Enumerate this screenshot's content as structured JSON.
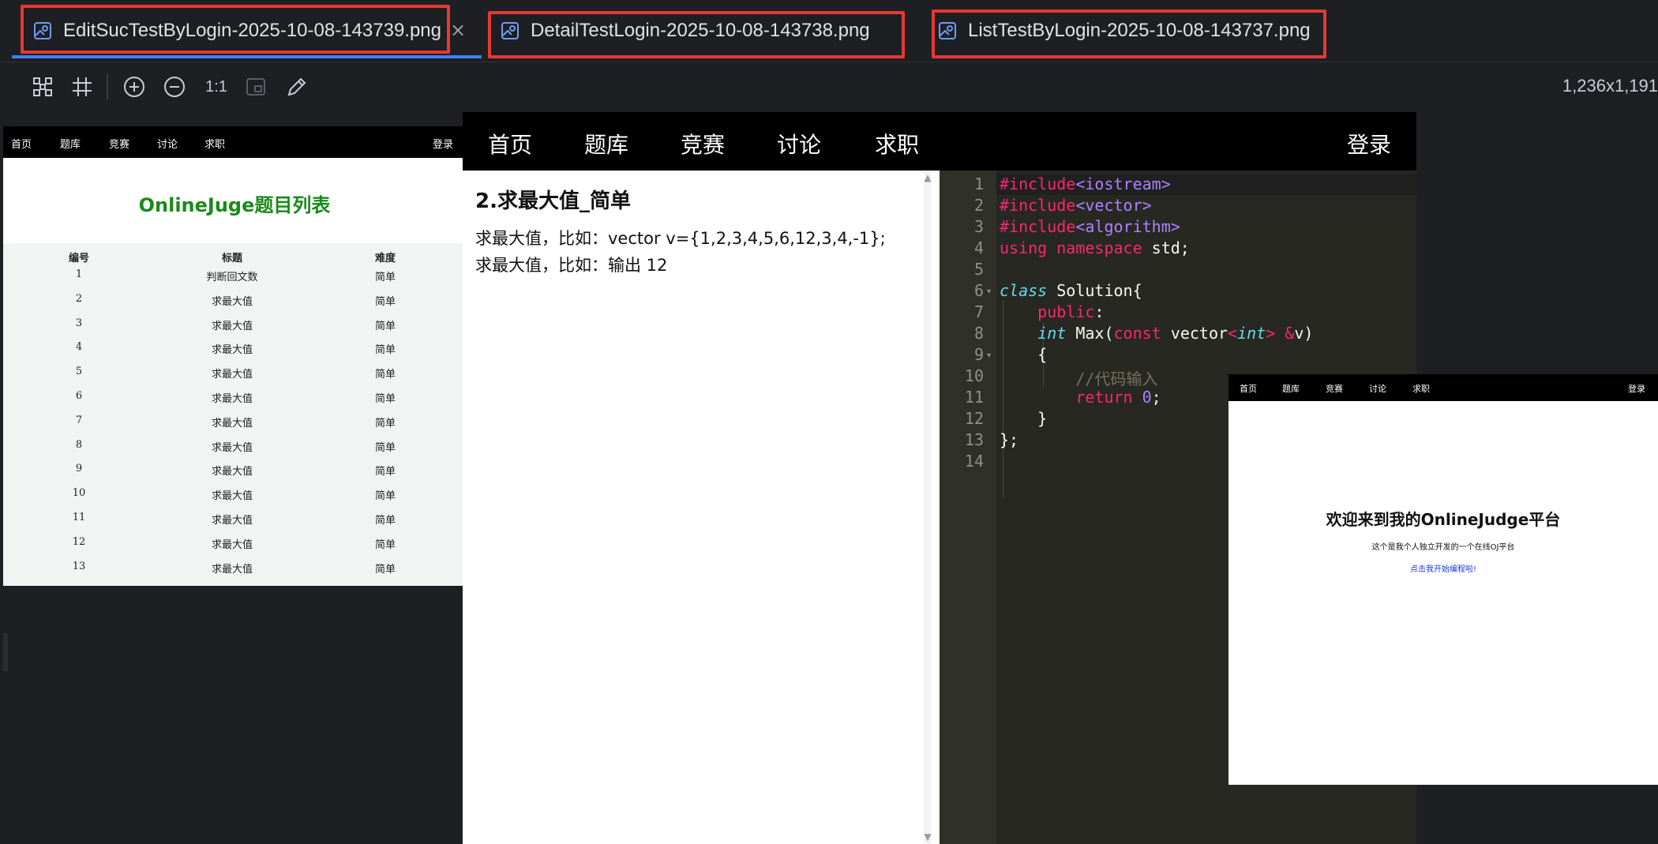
{
  "tabs": [
    {
      "label": "EditSucTestByLogin-2025-10-08-143739.png",
      "active": true
    },
    {
      "label": "DetailTestLogin-2025-10-08-143738.png",
      "active": false
    },
    {
      "label": "ListTestByLogin-2025-10-08-143737.png",
      "active": false
    }
  ],
  "tab_close_glyph": "×",
  "toolbar": {
    "icons": [
      "fit-screen-icon",
      "crop-icon",
      "zoom-in-icon",
      "zoom-out-icon",
      "actual-size",
      "fit-window-icon",
      "edit-pen-icon"
    ],
    "actual_size_label": "1:1",
    "dimensions": "1,236x1,191"
  },
  "list_page": {
    "nav": [
      "首页",
      "题库",
      "竞赛",
      "讨论",
      "求职"
    ],
    "login": "登录",
    "title": "OnlineJuge题目列表",
    "headers": [
      "编号",
      "标题",
      "难度"
    ],
    "rows": [
      [
        "1",
        "判断回文数",
        "简单"
      ],
      [
        "2",
        "求最大值",
        "简单"
      ],
      [
        "3",
        "求最大值",
        "简单"
      ],
      [
        "4",
        "求最大值",
        "简单"
      ],
      [
        "5",
        "求最大值",
        "简单"
      ],
      [
        "6",
        "求最大值",
        "简单"
      ],
      [
        "7",
        "求最大值",
        "简单"
      ],
      [
        "8",
        "求最大值",
        "简单"
      ],
      [
        "9",
        "求最大值",
        "简单"
      ],
      [
        "10",
        "求最大值",
        "简单"
      ],
      [
        "11",
        "求最大值",
        "简单"
      ],
      [
        "12",
        "求最大值",
        "简单"
      ],
      [
        "13",
        "求最大值",
        "简单"
      ]
    ]
  },
  "detail_page": {
    "nav": [
      "首页",
      "题库",
      "竞赛",
      "讨论",
      "求职"
    ],
    "login": "登录",
    "question_title": "2.求最大值_简单",
    "description": [
      "求最大值，比如：vector v={1,2,3,4,5,6,12,3,4,-1};",
      "求最大值，比如：输出 12"
    ],
    "line_numbers": [
      "1",
      "2",
      "3",
      "4",
      "5",
      "6",
      "7",
      "8",
      "9",
      "10",
      "11",
      "12",
      "13",
      "14"
    ]
  },
  "home_page": {
    "nav": [
      "首页",
      "题库",
      "竞赛",
      "讨论",
      "求职"
    ],
    "login": "登录",
    "title": "欢迎来到我的OnlineJudge平台",
    "subtitle": "这个是我个人独立开发的一个在线OJ平台",
    "link": "点击我开始编程啦!"
  },
  "colors": {
    "tab_highlight": "#e53935",
    "active_underline": "#3b82f6",
    "list_title": "#1a8a1a"
  }
}
